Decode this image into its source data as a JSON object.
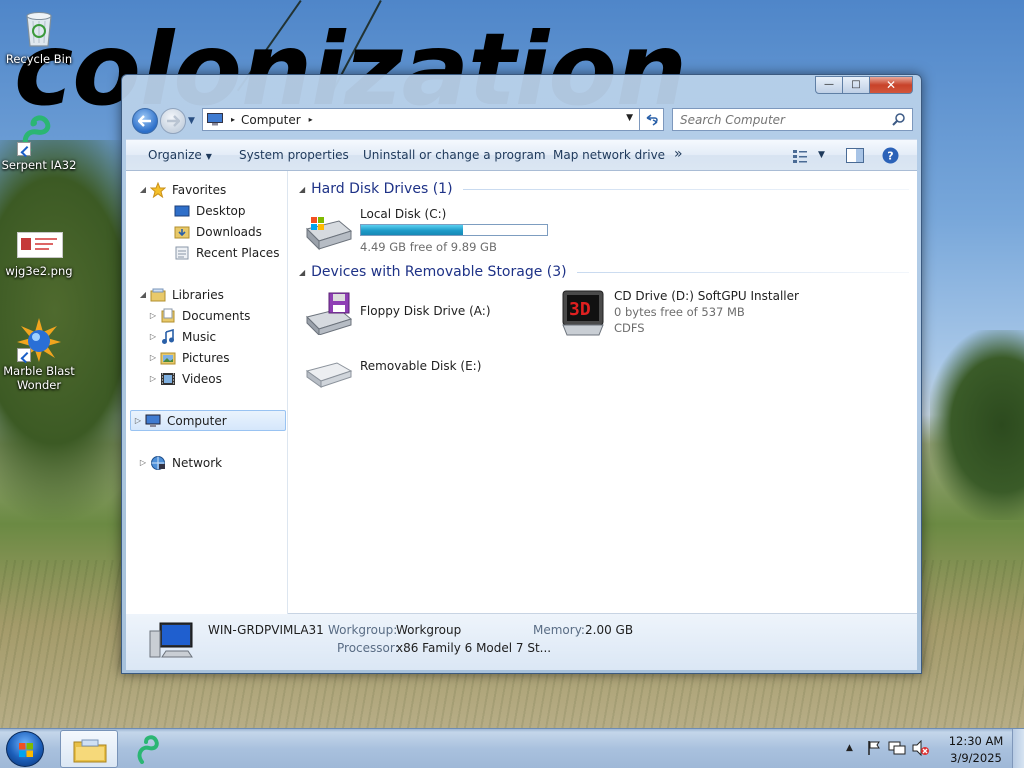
{
  "desktop": {
    "wallpaper_text": "colonization",
    "icons": [
      {
        "label": "Recycle Bin",
        "icon": "recycle-bin-icon"
      },
      {
        "label": "Serpent IA32",
        "icon": "serpent-snake-icon"
      },
      {
        "label": "wjg3e2.png",
        "icon": "png-image-icon"
      },
      {
        "label": "Marble Blast Wonder",
        "icon": "marble-blast-icon"
      }
    ]
  },
  "window": {
    "controls": {
      "minimize": "—",
      "maximize": "□",
      "close": "✕"
    },
    "address": {
      "crumb": "Computer",
      "separator": "▸"
    },
    "search": {
      "placeholder": "Search Computer"
    },
    "toolbar": {
      "organize": "Organize",
      "system_properties": "System properties",
      "uninstall": "Uninstall or change a program",
      "map_drive": "Map network drive",
      "more": "»"
    },
    "nav": {
      "favorites": "Favorites",
      "desktop": "Desktop",
      "downloads": "Downloads",
      "recent": "Recent Places",
      "libraries": "Libraries",
      "documents": "Documents",
      "music": "Music",
      "pictures": "Pictures",
      "videos": "Videos",
      "computer": "Computer",
      "network": "Network"
    },
    "groups": {
      "hdd": {
        "title": "Hard Disk Drives (1)",
        "drives": [
          {
            "name": "Local Disk (C:)",
            "free": "4.49 GB free of 9.89 GB",
            "used_fraction": 0.546
          }
        ]
      },
      "removable": {
        "title": "Devices with Removable Storage (3)",
        "drives": [
          {
            "name": "Floppy Disk Drive (A:)"
          },
          {
            "name": "CD Drive (D:) SoftGPU Installer",
            "free": "0 bytes free of 537 MB",
            "fs": "CDFS",
            "badge": "3D"
          },
          {
            "name": "Removable Disk (E:)"
          }
        ]
      }
    },
    "details": {
      "computer_name": "WIN-GRDPVIMLA31",
      "workgroup_label": "Workgroup:",
      "workgroup": "Workgroup",
      "memory_label": "Memory:",
      "memory": "2.00 GB",
      "processor_label": "Processor:",
      "processor": "x86 Family 6 Model 7 St..."
    }
  },
  "taskbar": {
    "time": "12:30 AM",
    "date": "3/9/2025"
  }
}
